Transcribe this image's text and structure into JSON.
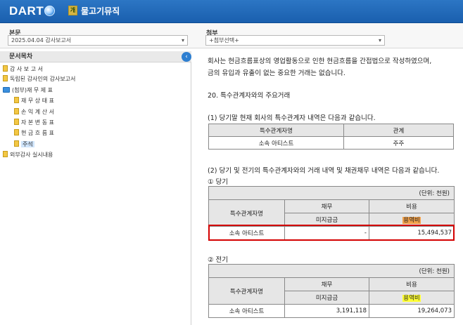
{
  "header": {
    "logo": "DART",
    "corp_badge": "개",
    "corp_name": "물고기뮤직"
  },
  "selectors": {
    "main_label": "본문",
    "main_value": "2025.04.04 감사보고서",
    "attach_label": "첨부",
    "attach_value": "+첨부선택+"
  },
  "toc": {
    "title": "문서목차",
    "items": [
      {
        "label": "감 사 보 고 서"
      },
      {
        "label": "독립된 감사인의 감사보고서"
      },
      {
        "label": "(첨부)재 무 제 표"
      },
      {
        "label": "재 무 상 태 표"
      },
      {
        "label": "손 익 계 산 서"
      },
      {
        "label": "자 본 변 동 표"
      },
      {
        "label": "현 금 흐 름 표"
      },
      {
        "label": "주석"
      },
      {
        "label": "외부감사 실시내용"
      }
    ]
  },
  "content": {
    "intro_line1": "회사는 현금흐름표상의 영업활동으로 인한 현금흐름을 간접법으로 작성하였으며,",
    "intro_line2": "금의 유입과 유출이 없는 중요한 거래는 없습니다.",
    "section_title": "20. 특수관계자와의 주요거래",
    "sub1": "(1) 당기말 현재 회사의 특수관계자 내역은 다음과 같습니다.",
    "rel_table": {
      "headers": [
        "특수관계자명",
        "관계"
      ],
      "row": [
        "소속 아티스트",
        "주주"
      ]
    },
    "sub2": "(2) 당기 및 전기의 특수관계자와의 거래 내역 및 채권채무 내역은 다음과 같습니다.",
    "current": {
      "label": "① 당기",
      "unit": "(단위: 천원)",
      "col_name": "특수관계자명",
      "col_debt": "채무",
      "col_cost": "비용",
      "sub_debt": "미지급금",
      "sub_cost": "용역비",
      "row_name": "소속 아티스트",
      "row_debt": "-",
      "row_cost": "15,494,537"
    },
    "prior": {
      "label": "② 전기",
      "unit": "(단위: 천원)",
      "col_name": "특수관계자명",
      "col_debt": "채무",
      "col_cost": "비용",
      "sub_debt": "미지급금",
      "sub_cost": "용역비",
      "row_name": "소속 아티스트",
      "row_debt": "3,191,118",
      "row_cost": "19,264,073"
    }
  }
}
